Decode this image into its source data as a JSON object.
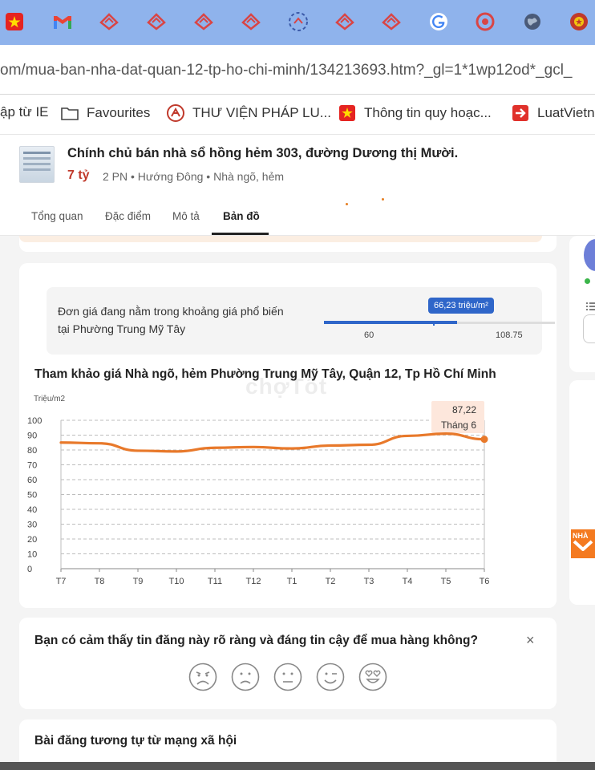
{
  "browser": {
    "tabs": [
      {
        "icon": "vietnam-flag-icon"
      },
      {
        "icon": "gmail-icon"
      },
      {
        "icon": "diamond-logo-icon"
      },
      {
        "icon": "diamond-logo-icon"
      },
      {
        "icon": "diamond-logo-icon"
      },
      {
        "icon": "diamond-logo-icon"
      },
      {
        "icon": "loading-spinner-icon"
      },
      {
        "icon": "diamond-logo-icon"
      },
      {
        "icon": "diamond-logo-icon"
      },
      {
        "icon": "google-icon"
      },
      {
        "icon": "red-circle-icon"
      },
      {
        "icon": "globe-icon"
      },
      {
        "icon": "emblem-icon"
      }
    ],
    "url": "om/mua-ban-nha-dat-quan-12-tp-ho-chi-minh/134213693.htm?_gl=1*1wp12od*_gcl_",
    "bookmarks": [
      {
        "label": "ập từ IE"
      },
      {
        "label": "Favourites",
        "icon": "folder-icon"
      },
      {
        "label": "THƯ VIỆN PHÁP LU...",
        "icon": "law-library-icon"
      },
      {
        "label": "Thông tin quy hoạc...",
        "icon": "vietnam-flag-icon"
      },
      {
        "label": "LuatVietna",
        "icon": "arrow-right-icon"
      }
    ]
  },
  "listing": {
    "title": "Chính chủ bán nhà sổ hồng hẻm 303, đường Dương thị Mười.",
    "price": "7 tỷ",
    "meta": "2 PN • Hướng Đông • Nhà ngõ, hẻm",
    "tabs": [
      "Tổng quan",
      "Đặc điểm",
      "Mô tả",
      "Bản đồ"
    ],
    "active_tab": "Bản đồ"
  },
  "price_range": {
    "text": "Đơn giá đang nằm trong khoảng giá phổ biến tại Phường Trung Mỹ Tây",
    "current_label": "66,23 triệu/m²",
    "min": "60",
    "max": "108.75",
    "accent": "#2f66c9"
  },
  "chart_title": "Tham khảo giá Nhà ngõ, hẻm Phường Trung Mỹ Tây, Quận 12, Tp Hồ Chí Minh",
  "watermark": "chợTốt",
  "chart_data": {
    "type": "line",
    "ylabel": "Triệu/m2",
    "categories": [
      "T7",
      "T8",
      "T9",
      "T10",
      "T11",
      "T12",
      "T1",
      "T2",
      "T3",
      "T4",
      "T5",
      "T6"
    ],
    "yticks": [
      "0",
      "10",
      "20",
      "30",
      "40",
      "50",
      "60",
      "70",
      "80",
      "90",
      "100"
    ],
    "ylim": [
      0,
      100
    ],
    "grid": true,
    "values": [
      85,
      84.5,
      79.5,
      79,
      81.5,
      82,
      81,
      83,
      83.5,
      89.5,
      91,
      87.22
    ],
    "tooltip": {
      "value": "87,22",
      "label": "Tháng 6"
    },
    "color": "#e8792b"
  },
  "feedback": {
    "question": "Bạn có cảm thấy tin đăng này rõ ràng và đáng tin cậy để mua hàng không?",
    "close": "×",
    "faces": [
      "angry-face-icon",
      "sad-face-icon",
      "neutral-face-icon",
      "wink-face-icon",
      "heart-eyes-face-icon"
    ]
  },
  "social_title": "Bài đăng tương tự từ mạng xã hội",
  "sidebar": {
    "badge": "NHÀ"
  }
}
